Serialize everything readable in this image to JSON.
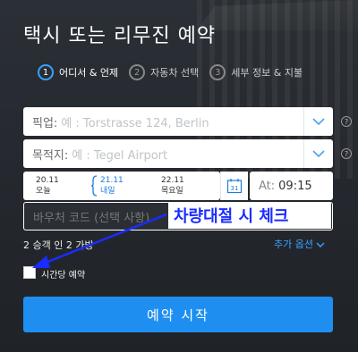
{
  "header": {
    "title": "택시 또는 리무진 예약"
  },
  "steps": [
    {
      "num": "1",
      "label": "어디서 & 언제"
    },
    {
      "num": "2",
      "label": "자동차 선택"
    },
    {
      "num": "3",
      "label": "세부 정보 & 지불"
    }
  ],
  "pickup": {
    "label": "픽업:",
    "placeholder": "예 : Torstrasse 124, Berlin"
  },
  "destination": {
    "label": "목적지:",
    "placeholder": "예 : Tegel Airport"
  },
  "help_symbol": "?",
  "dates": [
    {
      "date": "20.11",
      "day": "오늘"
    },
    {
      "date": "21.11",
      "day": "내일"
    },
    {
      "date": "22.11",
      "day": "목요일"
    }
  ],
  "calendar": {
    "day": "31"
  },
  "time": {
    "prefix": "At:",
    "value": "09:15"
  },
  "voucher": {
    "placeholder": "바우처 코드 (선택 사항)"
  },
  "annotation": {
    "text": "차량대절 시 체크"
  },
  "passengers": {
    "text": "2 승객 인 2 가방"
  },
  "more_options": {
    "label": "추가 옵션"
  },
  "hourly": {
    "label": "시간당 예약",
    "checked": false
  },
  "submit": {
    "label": "예약 시작"
  },
  "colors": {
    "accent": "#1e8ff0",
    "annotation": "#1a2cff"
  }
}
